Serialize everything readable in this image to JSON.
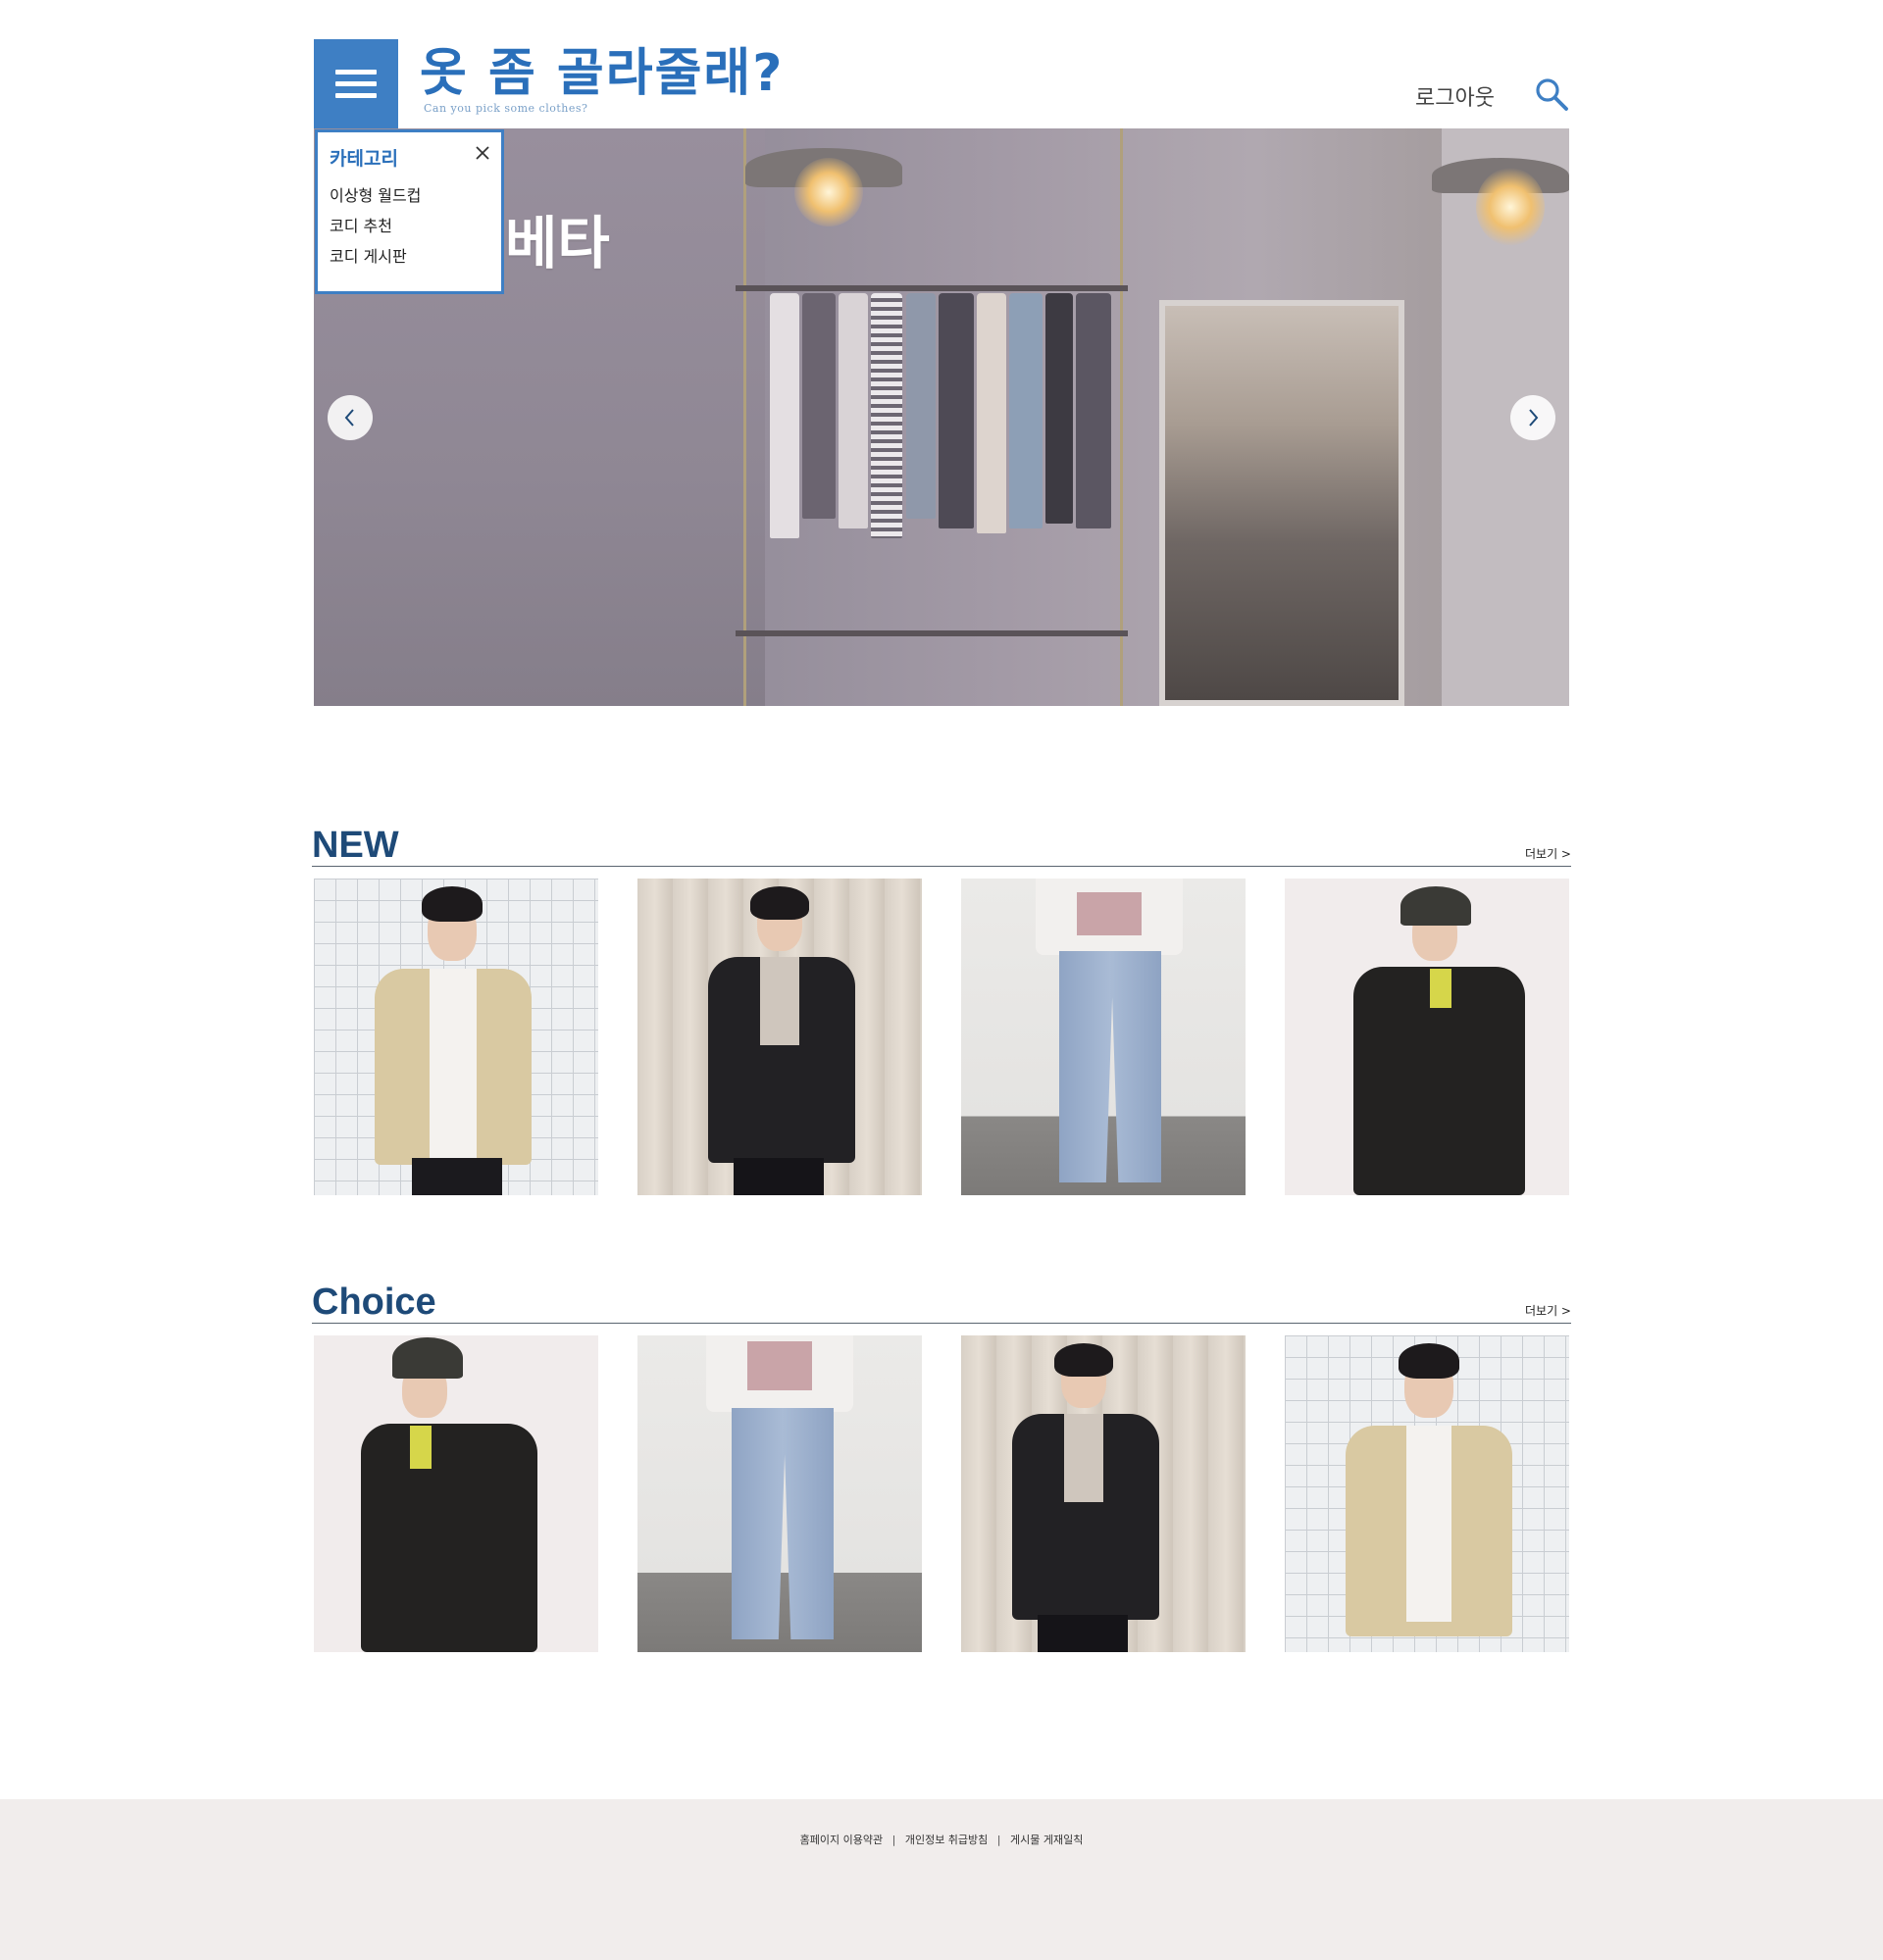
{
  "header": {
    "logo_title": "옷 좀 골라줄래?",
    "logo_subtitle": "Can you pick some clothes?",
    "logout_label": "로그아웃",
    "brand_color": "#3e7fc4"
  },
  "hero": {
    "text": "베타"
  },
  "category_menu": {
    "title": "카테고리",
    "items": [
      {
        "label": "이상형 월드컵"
      },
      {
        "label": "코디 추천"
      },
      {
        "label": "코디 게시판"
      }
    ]
  },
  "sections": {
    "new": {
      "title": "NEW",
      "more_label": "더보기 >",
      "products": [
        {
          "item": "beige-denim-jacket"
        },
        {
          "item": "black-leather-rider-jacket"
        },
        {
          "item": "light-wash-wide-jeans"
        },
        {
          "item": "black-shirt-jacket-bucket-hat"
        }
      ]
    },
    "choice": {
      "title": "Choice",
      "more_label": "더보기 >",
      "products": [
        {
          "item": "black-shirt-jacket-bucket-hat"
        },
        {
          "item": "light-wash-wide-jeans"
        },
        {
          "item": "black-leather-rider-jacket"
        },
        {
          "item": "beige-denim-jacket"
        }
      ]
    }
  },
  "footer": {
    "links": [
      {
        "label": "홈페이지 이용약관"
      },
      {
        "label": "개인정보 취급방침"
      },
      {
        "label": "게시물 게재일칙"
      }
    ],
    "separator": "|"
  },
  "colors": {
    "section_title": "#1e4a78",
    "footer_bg": "#f1edec"
  }
}
